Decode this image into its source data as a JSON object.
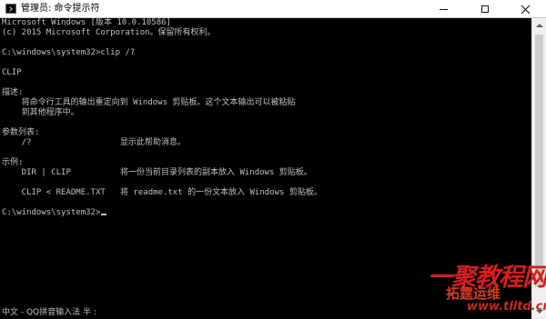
{
  "window": {
    "title": "管理员: 命令提示符",
    "icon": "cmd-icon",
    "controls": [
      "minimize-icon",
      "maximize-icon",
      "close-icon"
    ]
  },
  "console": {
    "lines": [
      "Microsoft Windows [版本 10.0.10586]",
      "(c) 2015 Microsoft Corporation。保留所有权利。",
      "",
      "C:\\windows\\system32>clip /?",
      "",
      "CLIP",
      "",
      "描述:",
      "    将命令行工具的输出重定向到 Windows 剪贴板。这个文本输出可以被粘贴",
      "    到其他程序中。",
      "",
      "参数列表:",
      "    /?                  显示此帮助消息。",
      "",
      "示例:",
      "    DIR | CLIP          将一份当前目录列表的副本放入 Windows 剪贴板。",
      "",
      "    CLIP < README.TXT   将 readme.txt 的一份文本放入 Windows 剪贴板。",
      "",
      "C:\\windows\\system32>"
    ]
  },
  "ime_status": "中文 - QQ拼音输入法 半 :",
  "watermark": {
    "line1": "一聚教程网",
    "line2": "拓霆运维",
    "line3": "www.tlltd.cn"
  },
  "colors": {
    "console_bg": "#000000",
    "console_fg": "#c0c0c0",
    "titlebar_bg": "#ffffff",
    "watermark": "#d81d1d"
  }
}
